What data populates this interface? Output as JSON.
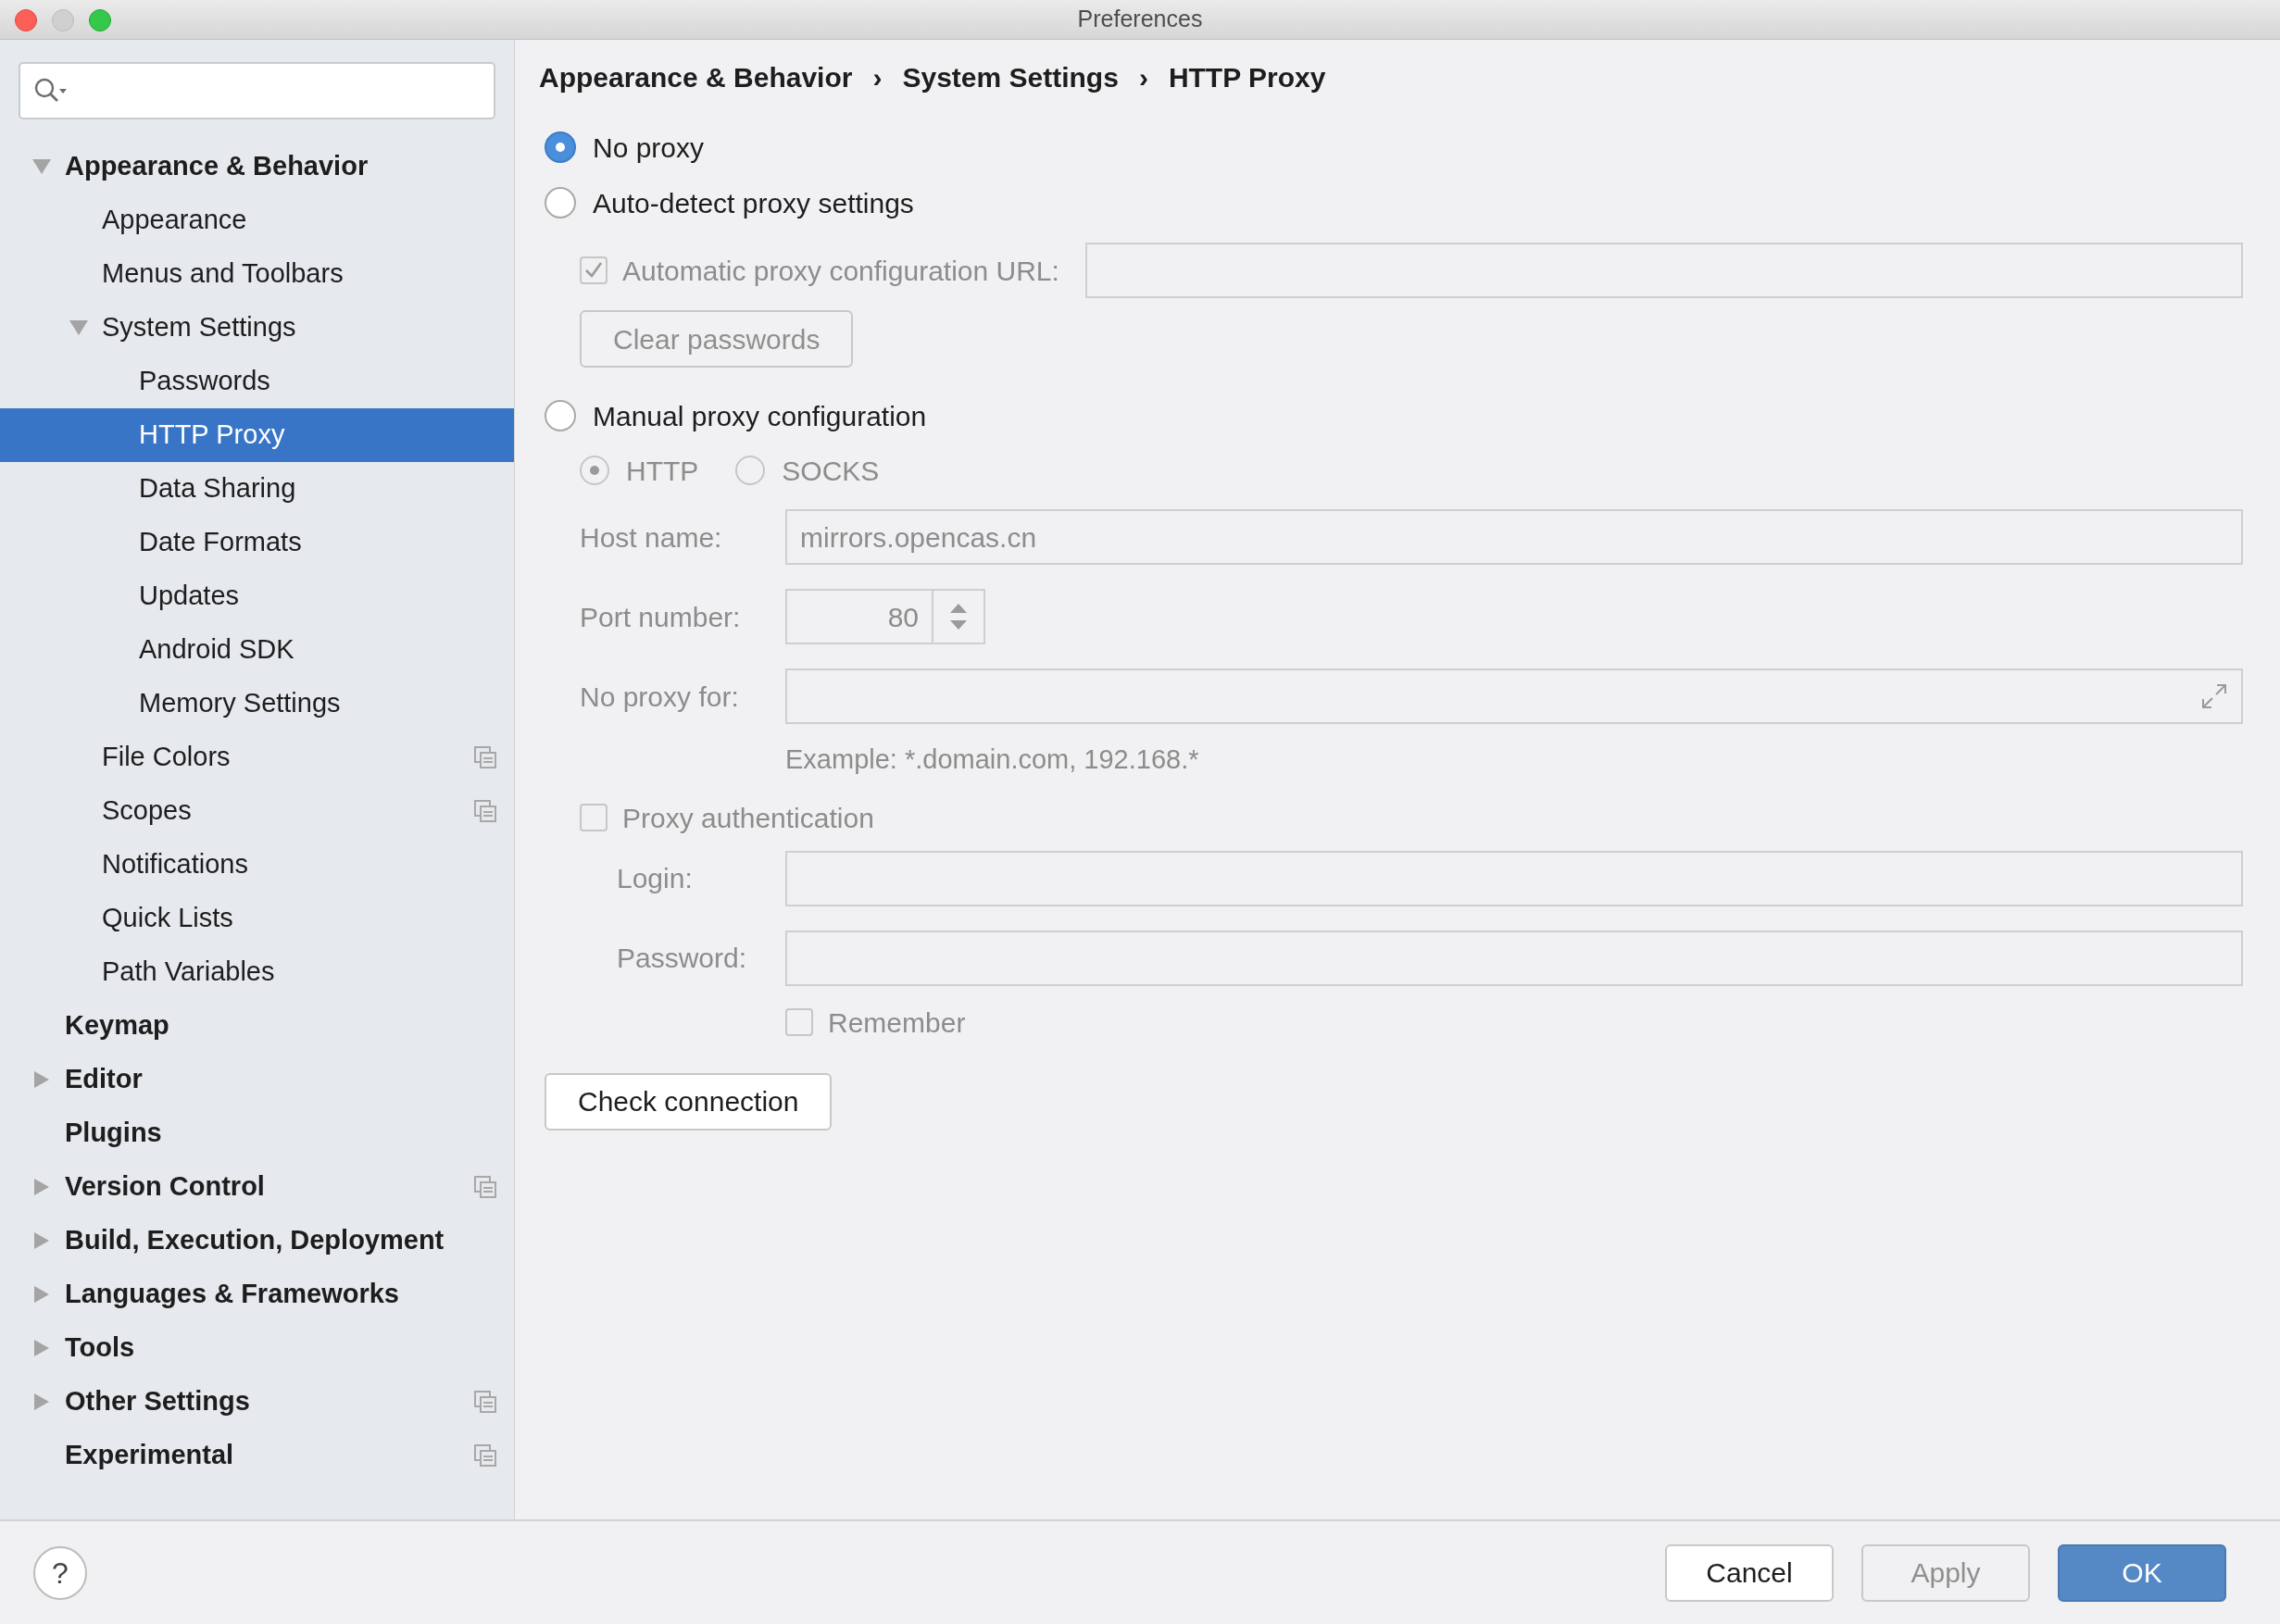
{
  "window": {
    "title": "Preferences"
  },
  "sidebar": {
    "items": [
      {
        "label": "Appearance & Behavior",
        "expanded": true,
        "selected": false,
        "children": [
          {
            "label": "Appearance",
            "selected": false
          },
          {
            "label": "Menus and Toolbars",
            "selected": false
          },
          {
            "label": "System Settings",
            "expanded": true,
            "selected": false,
            "children": [
              {
                "label": "Passwords",
                "selected": false
              },
              {
                "label": "HTTP Proxy",
                "selected": true
              },
              {
                "label": "Data Sharing",
                "selected": false
              },
              {
                "label": "Date Formats",
                "selected": false
              },
              {
                "label": "Updates",
                "selected": false
              },
              {
                "label": "Android SDK",
                "selected": false
              },
              {
                "label": "Memory Settings",
                "selected": false
              }
            ]
          },
          {
            "label": "File Colors",
            "selected": false,
            "project_level": true
          },
          {
            "label": "Scopes",
            "selected": false,
            "project_level": true
          },
          {
            "label": "Notifications",
            "selected": false
          },
          {
            "label": "Quick Lists",
            "selected": false
          },
          {
            "label": "Path Variables",
            "selected": false
          }
        ]
      },
      {
        "label": "Keymap",
        "selected": false
      },
      {
        "label": "Editor",
        "expanded": false,
        "selected": false
      },
      {
        "label": "Plugins",
        "selected": false
      },
      {
        "label": "Version Control",
        "expanded": false,
        "selected": false,
        "project_level": true
      },
      {
        "label": "Build, Execution, Deployment",
        "expanded": false,
        "selected": false
      },
      {
        "label": "Languages & Frameworks",
        "expanded": false,
        "selected": false
      },
      {
        "label": "Tools",
        "expanded": false,
        "selected": false
      },
      {
        "label": "Other Settings",
        "expanded": false,
        "selected": false,
        "project_level": true
      },
      {
        "label": "Experimental",
        "selected": false,
        "project_level": true
      }
    ]
  },
  "breadcrumb": [
    "Appearance & Behavior",
    "System Settings",
    "HTTP Proxy"
  ],
  "breadcrumb_separator": "›",
  "proxy_modes": [
    {
      "label": "No proxy",
      "selected": true
    },
    {
      "label": "Auto-detect proxy settings",
      "selected": false
    },
    {
      "label": "Manual proxy configuration",
      "selected": false
    }
  ],
  "auto_detect": {
    "disabled": true,
    "pac_checkbox": {
      "label": "Automatic proxy configuration URL:",
      "checked": true
    },
    "clear_passwords": "Clear passwords"
  },
  "manual": {
    "disabled": true,
    "protocols": [
      {
        "label": "HTTP",
        "selected": true
      },
      {
        "label": "SOCKS",
        "selected": false
      }
    ],
    "host": {
      "label": "Host name:",
      "value": "mirrors.opencas.cn"
    },
    "port": {
      "label": "Port number:",
      "value": "80"
    },
    "no_proxy": {
      "label": "No proxy for:"
    },
    "example": "Example: *.domain.com, 192.168.*",
    "auth": {
      "label": "Proxy authentication",
      "checked": false
    },
    "login": {
      "label": "Login:"
    },
    "password": {
      "label": "Password:"
    },
    "remember": {
      "label": "Remember",
      "checked": false
    }
  },
  "check_connection": "Check connection",
  "help": "?",
  "buttons": [
    {
      "label": "Cancel",
      "kind": "default"
    },
    {
      "label": "Apply",
      "kind": "disabled"
    },
    {
      "label": "OK",
      "kind": "primary"
    }
  ]
}
